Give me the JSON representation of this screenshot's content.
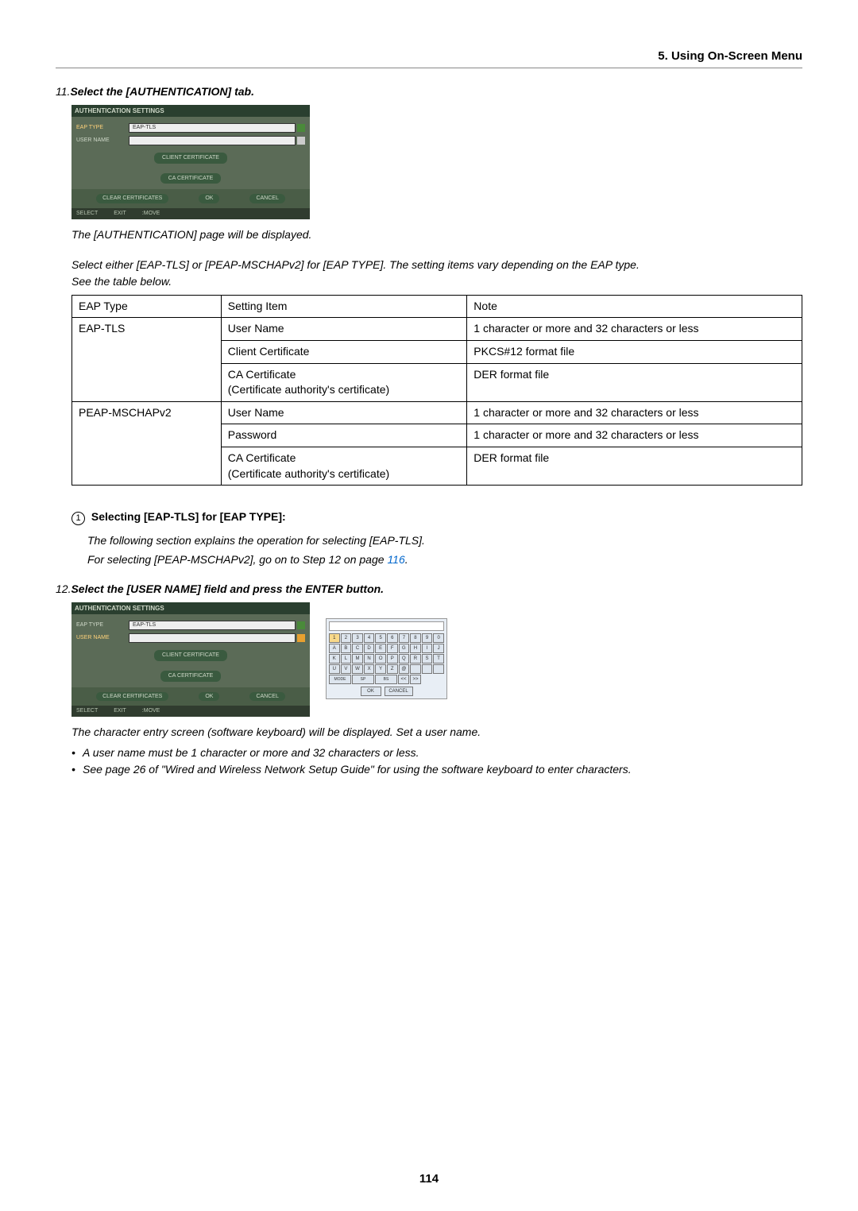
{
  "header": "5. Using On-Screen Menu",
  "step11": {
    "num": "11.",
    "text": "Select the [AUTHENTICATION] tab."
  },
  "screenshot": {
    "title": "AUTHENTICATION SETTINGS",
    "eap_type_label": "EAP TYPE",
    "eap_type_value": "EAP-TLS",
    "user_name_label": "USER NAME",
    "client_cert_btn": "CLIENT CERTIFICATE",
    "ca_cert_btn": "CA CERTIFICATE",
    "clear_btn": "CLEAR CERTIFICATES",
    "ok_btn": "OK",
    "cancel_btn": "CANCEL",
    "foot_select": "SELECT",
    "foot_exit": "EXIT",
    "foot_move": ":MOVE"
  },
  "para1": "The [AUTHENTICATION] page will be displayed.",
  "para2": "Select either [EAP-TLS] or [PEAP-MSCHAPv2] for [EAP TYPE]. The setting items vary depending on the EAP type.",
  "para3": "See the table below.",
  "table": {
    "headers": [
      "EAP Type",
      "Setting Item",
      "Note"
    ],
    "rows": [
      {
        "eap": "EAP-TLS",
        "item": "User Name",
        "note": "1 character or more and 32 characters or less",
        "rowspan": 3
      },
      {
        "eap": "",
        "item": "Client Certificate",
        "note": "PKCS#12 format file"
      },
      {
        "eap": "",
        "item": "CA Certificate\n(Certificate authority's certificate)",
        "note": "DER format file"
      },
      {
        "eap": "PEAP-MSCHAPv2",
        "item": "User Name",
        "note": "1 character or more and 32 characters or less",
        "rowspan": 3
      },
      {
        "eap": "",
        "item": "Password",
        "note": "1 character or more and 32 characters or less"
      },
      {
        "eap": "",
        "item": "CA Certificate\n(Certificate authority's certificate)",
        "note": "DER format file"
      }
    ]
  },
  "section1": {
    "circled": "1",
    "title": "Selecting [EAP-TLS] for [EAP TYPE]:",
    "line1": "The following section explains the operation for selecting [EAP-TLS].",
    "line2_a": "For selecting [PEAP-MSCHAPv2], go on to Step 12 on page ",
    "line2_link": "116",
    "line2_b": "."
  },
  "step12": {
    "num": "12.",
    "text": "Select the [USER NAME] field and press the ENTER button."
  },
  "keyboard": {
    "row1": [
      "1",
      "2",
      "3",
      "4",
      "5",
      "6",
      "7",
      "8",
      "9",
      "0"
    ],
    "row2": [
      "A",
      "B",
      "C",
      "D",
      "E",
      "F",
      "G",
      "H",
      "I",
      "J"
    ],
    "row3": [
      "K",
      "L",
      "M",
      "N",
      "O",
      "P",
      "Q",
      "R",
      "S",
      "T"
    ],
    "row4": [
      "U",
      "V",
      "W",
      "X",
      "Y",
      "Z",
      "@",
      "",
      "",
      ""
    ],
    "bot": [
      "MODE",
      "SP",
      "BS",
      "<<",
      ">>"
    ],
    "ok": "OK",
    "cancel": "CANCEL"
  },
  "after_kb": "The character entry screen (software keyboard) will be displayed. Set a user name.",
  "bullets": [
    "A user name must be 1 character or more and 32 characters or less.",
    "See page 26 of \"Wired and Wireless Network Setup Guide\" for using the software keyboard to enter characters."
  ],
  "page_number": "114"
}
